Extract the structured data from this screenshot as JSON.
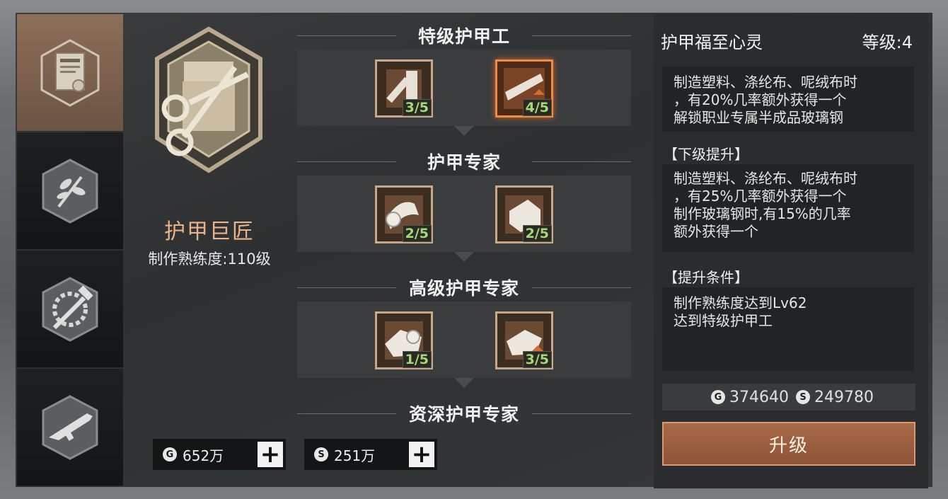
{
  "tabs": [
    {
      "icon": "certificate-icon",
      "active": true
    },
    {
      "icon": "plant-icon",
      "active": false
    },
    {
      "icon": "gear-hammer-icon",
      "active": false
    },
    {
      "icon": "rifle-icon",
      "active": false
    }
  ],
  "profession": {
    "name": "护甲巨匠",
    "proficiency": "制作熟练度:110级"
  },
  "currency": [
    {
      "symbol": "G",
      "amount": "652万"
    },
    {
      "symbol": "S",
      "amount": "251万"
    }
  ],
  "tiers": [
    {
      "title": "特级护甲工",
      "skills": [
        {
          "icon": "bandage-roll-icon",
          "progress": "3/5",
          "selected": false
        },
        {
          "icon": "metal-plate-icon",
          "progress": "4/5",
          "selected": true
        }
      ]
    },
    {
      "title": "护甲专家",
      "skills": [
        {
          "icon": "cloth-roll-icon",
          "progress": "2/5",
          "selected": false
        },
        {
          "icon": "fabric-bolt-icon",
          "progress": "2/5",
          "selected": false
        }
      ]
    },
    {
      "title": "高级护甲专家",
      "skills": [
        {
          "icon": "cloth-sheet-icon",
          "progress": "1/5",
          "selected": false
        },
        {
          "icon": "felt-roll-icon",
          "progress": "3/5",
          "selected": false
        }
      ]
    },
    {
      "title": "资深护甲专家",
      "skills": []
    }
  ],
  "detail": {
    "title": "护甲福至心灵",
    "level": "等级:4",
    "description": [
      "制造塑料、涤纶布、呢绒布时",
      "，有20%几率额外获得一个",
      "解锁职业专属半成品玻璃钢"
    ],
    "next_title": "【下级提升】",
    "next_description": [
      "制造塑料、涤纶布、呢绒布时",
      "，有25%几率额外获得一个",
      "制作玻璃钢时,有15%的几率",
      "额外获得一个"
    ],
    "cond_title": "【提升条件】",
    "conditions": [
      "制作熟练度达到Lv62",
      "达到特级护甲工"
    ],
    "cost": [
      {
        "symbol": "G",
        "amount": "374640"
      },
      {
        "symbol": "S",
        "amount": "249780"
      }
    ],
    "upgrade_label": "升级"
  },
  "colors": {
    "accent_orange": "#e9b487",
    "progress_green": "#a6d87a",
    "selected_border": "#f08a3c"
  }
}
